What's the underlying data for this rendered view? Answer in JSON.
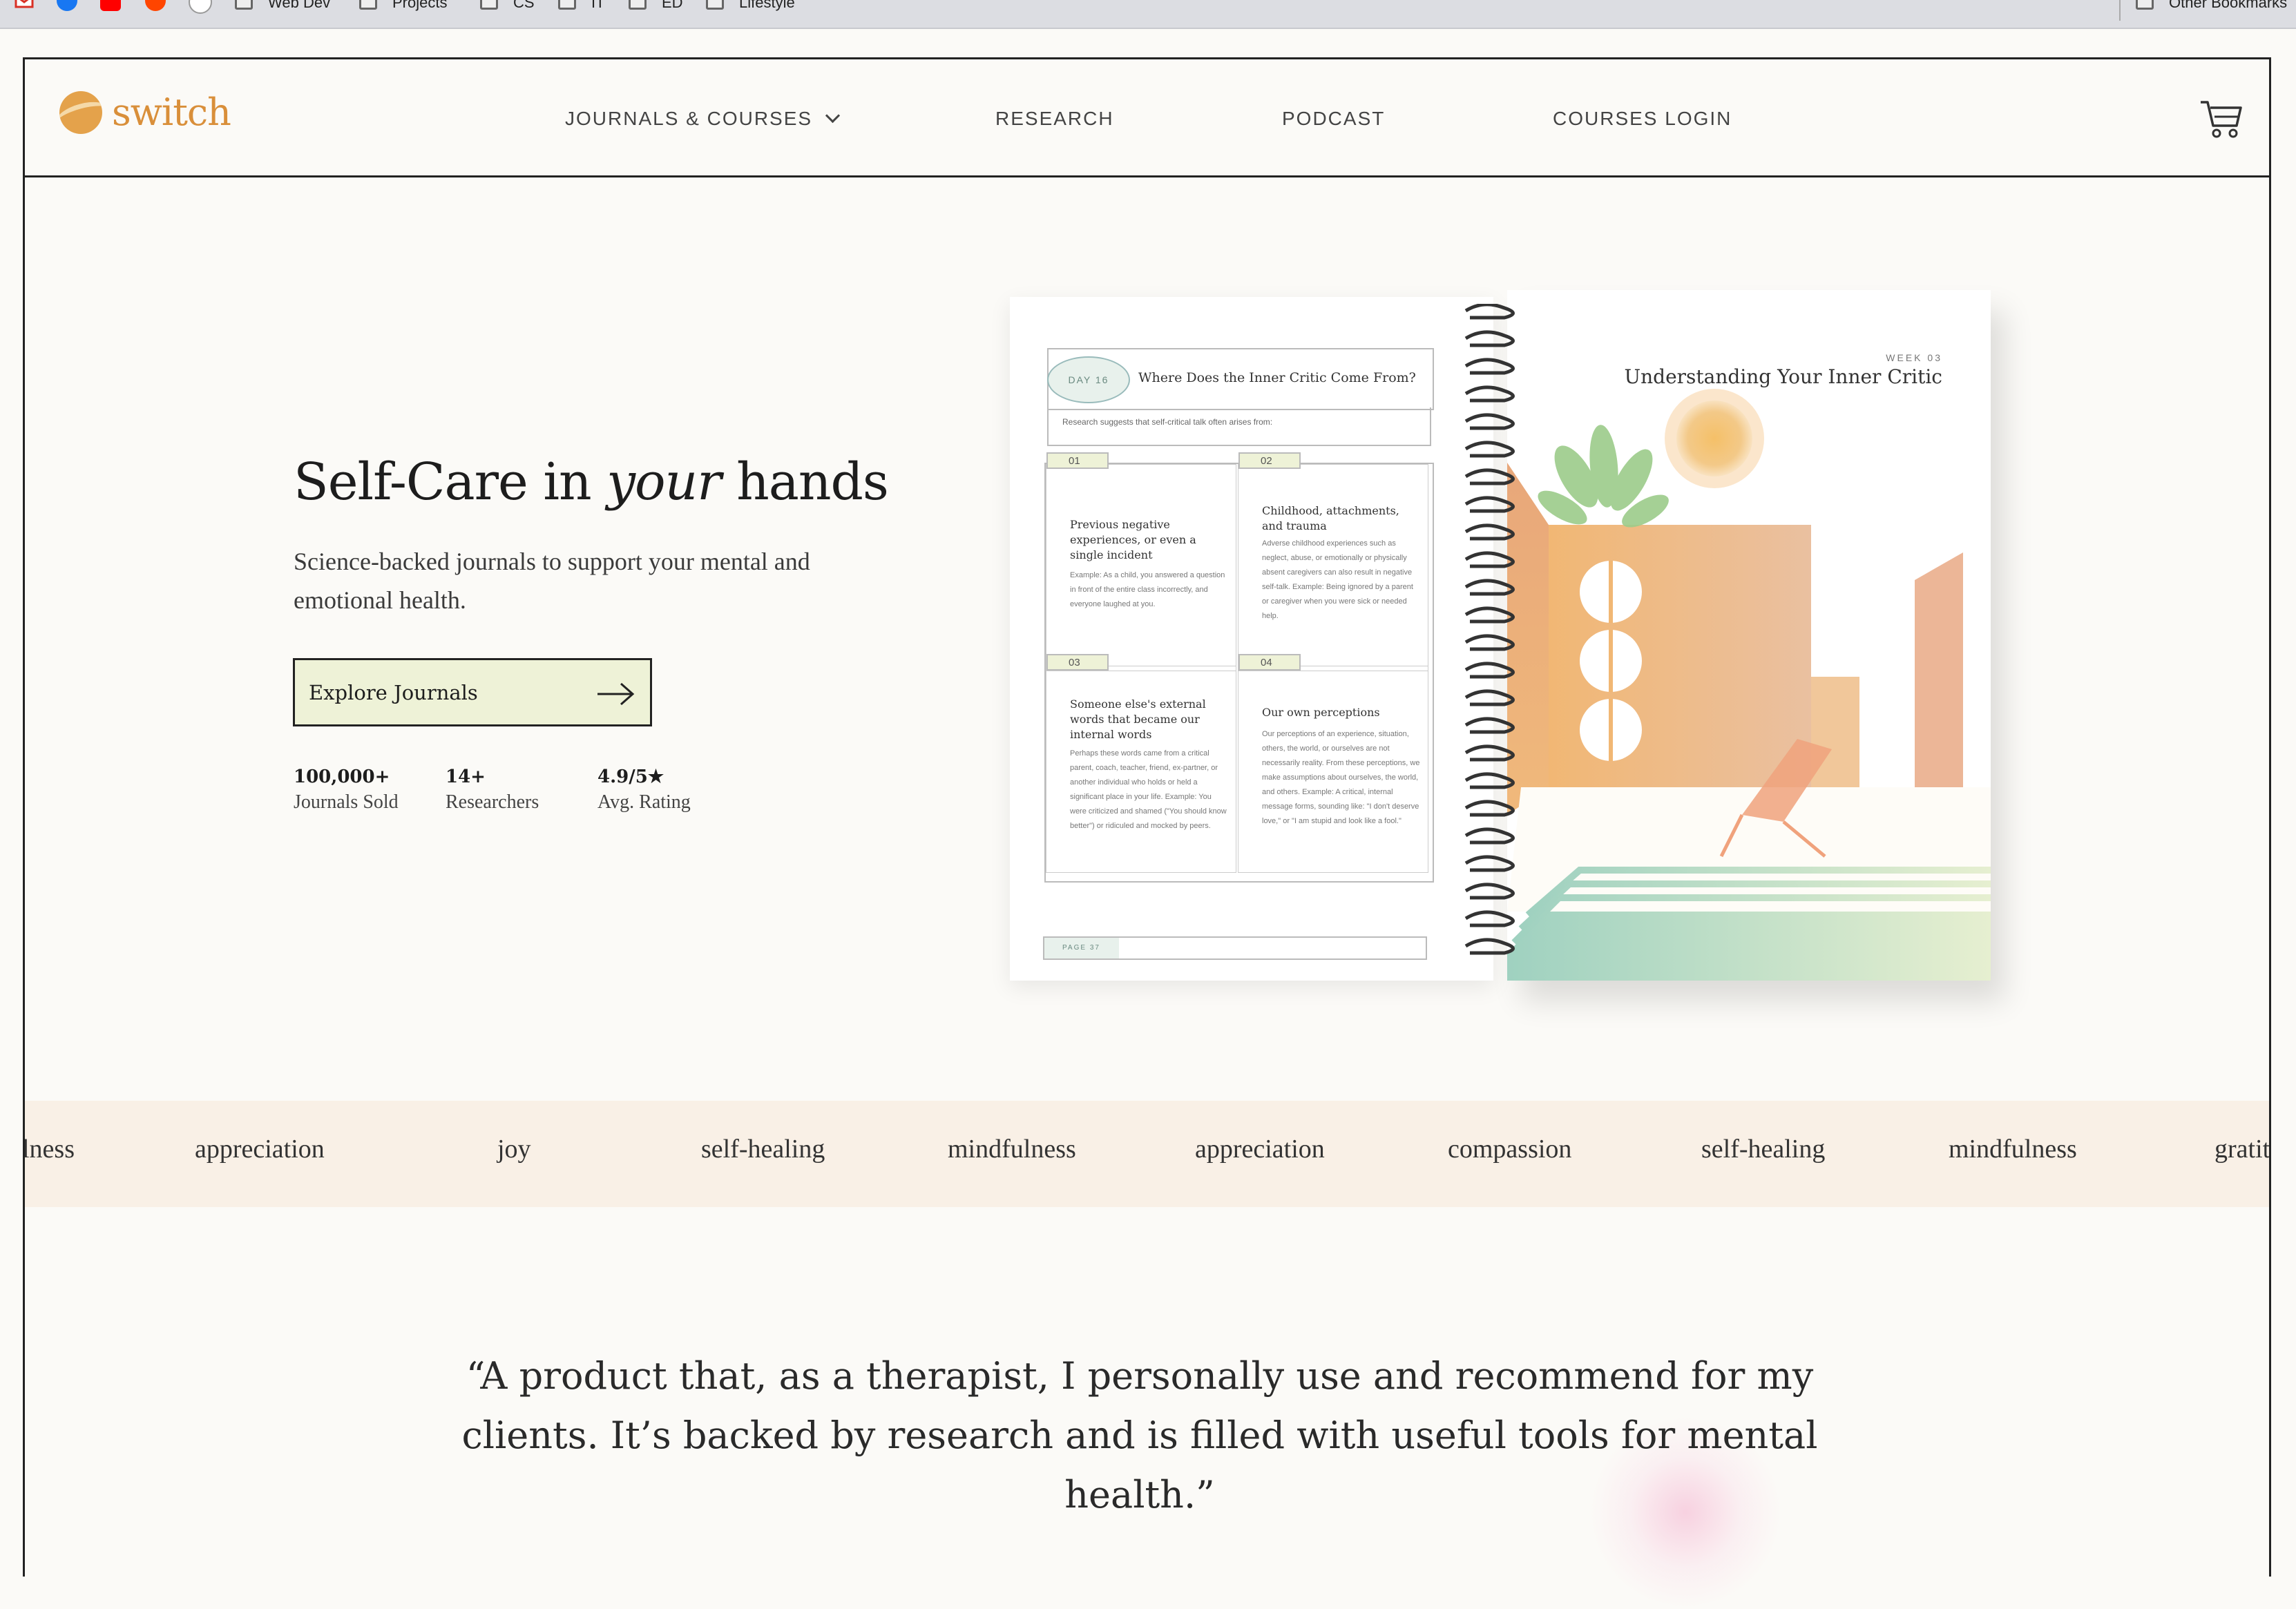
{
  "bookmarks": [
    "Web Dev",
    "Projects",
    "CS",
    "IT",
    "ED",
    "Lifestyle"
  ],
  "other_bookmarks": "Other Bookmarks",
  "brand": {
    "name": "switch",
    "accent": "#e4a24b"
  },
  "nav": {
    "items": [
      "JOURNALS & COURSES",
      "RESEARCH",
      "PODCAST",
      "COURSES LOGIN"
    ],
    "cart_icon": "cart-icon"
  },
  "hero": {
    "title_pre": "Self-Care in ",
    "title_em": "your",
    "title_post": " hands",
    "subtitle": "Science-backed journals to support your mental and emotional health.",
    "cta": "Explore Journals",
    "stats": [
      {
        "value": "100,000+",
        "label": "Journals Sold"
      },
      {
        "value": "14+",
        "label": "Researchers"
      },
      {
        "value": "4.9/5★",
        "label": "Avg. Rating"
      }
    ]
  },
  "journal": {
    "day": "DAY 16",
    "question": "Where Does the Inner Critic Come From?",
    "research_line": "Research suggests that self-critical talk often arises from:",
    "cells": [
      {
        "num": "01",
        "title": "Previous negative experiences, or even a single incident",
        "body": "Example: As a child, you answered a question in front of the entire class incorrectly, and everyone laughed at you."
      },
      {
        "num": "02",
        "title": "Childhood, attachments, and trauma",
        "body": "Adverse childhood experiences such as neglect, abuse, or emotionally or physically absent caregivers can also result in negative self-talk. Example: Being ignored by a parent or caregiver when you were sick or needed help."
      },
      {
        "num": "03",
        "title": "Someone else's external words that became our internal words",
        "body": "Perhaps these words came from a critical parent, coach, teacher, friend, ex-partner, or another individual who holds or held a significant place in your life. Example: You were criticized and shamed (\"You should know better\") or ridiculed and mocked by peers."
      },
      {
        "num": "04",
        "title": "Our own perceptions",
        "body": "Our perceptions of an experience, situation, others, the world, or ourselves are not necessarily reality. From these perceptions, we make assumptions about ourselves, the world, and others. Example: A critical, internal message forms, sounding like: \"I don't deserve love,\" or \"I am stupid and look like a fool.\""
      }
    ],
    "page": "PAGE 37",
    "week": "WEEK 03",
    "week_title": "Understanding Your Inner Critic"
  },
  "keywords": [
    "lness",
    "appreciation",
    "joy",
    "self-healing",
    "mindfulness",
    "appreciation",
    "compassion",
    "self-healing",
    "mindfulness",
    "gratit"
  ],
  "quote": "“A product that, as a therapist, I personally use and recommend for my clients. It’s backed by research and is filled with useful tools for mental health.”"
}
